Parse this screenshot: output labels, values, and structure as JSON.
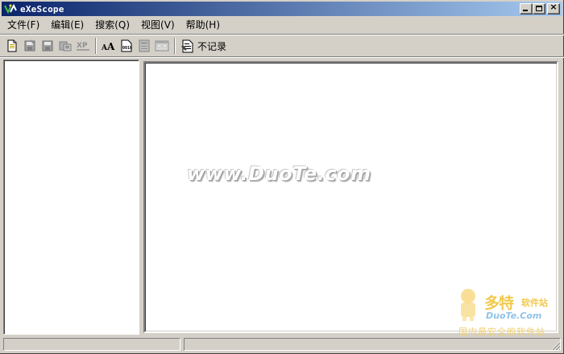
{
  "window": {
    "title": "eXeScope",
    "icon": "exescope-app-icon"
  },
  "caption_buttons": {
    "minimize": "minimize-icon",
    "maximize": "maximize-icon",
    "close_glyph": "×"
  },
  "menu": [
    {
      "label": "文件(F)"
    },
    {
      "label": "编辑(E)"
    },
    {
      "label": "搜索(Q)"
    },
    {
      "label": "视图(V)"
    },
    {
      "label": "帮助(H)"
    }
  ],
  "toolbar": {
    "buttons_group1": [
      "new-file-icon",
      "save-icon",
      "save-as-icon",
      "export-icon",
      "xp-icon"
    ],
    "buttons_group2": [
      "font-icon",
      "hex-dump-icon",
      "resource-icon",
      "dialog-icon"
    ],
    "record_label": "不记录",
    "record_icon": "record-toggle-icon",
    "xp_text": "XP",
    "font_text": "AA",
    "hex_text": "0010"
  },
  "content": {
    "watermark": "www.DuoTe.com"
  },
  "corner_logo": {
    "main": "多特",
    "sub": "软件站",
    "domain": "DuoTe.Com",
    "tagline": "国内最安全的软件站"
  },
  "status": {
    "panel1": "",
    "panel2": ""
  },
  "colors": {
    "titlebar_start": "#0a246a",
    "titlebar_end": "#a6caf0",
    "face": "#d4d0c8"
  }
}
